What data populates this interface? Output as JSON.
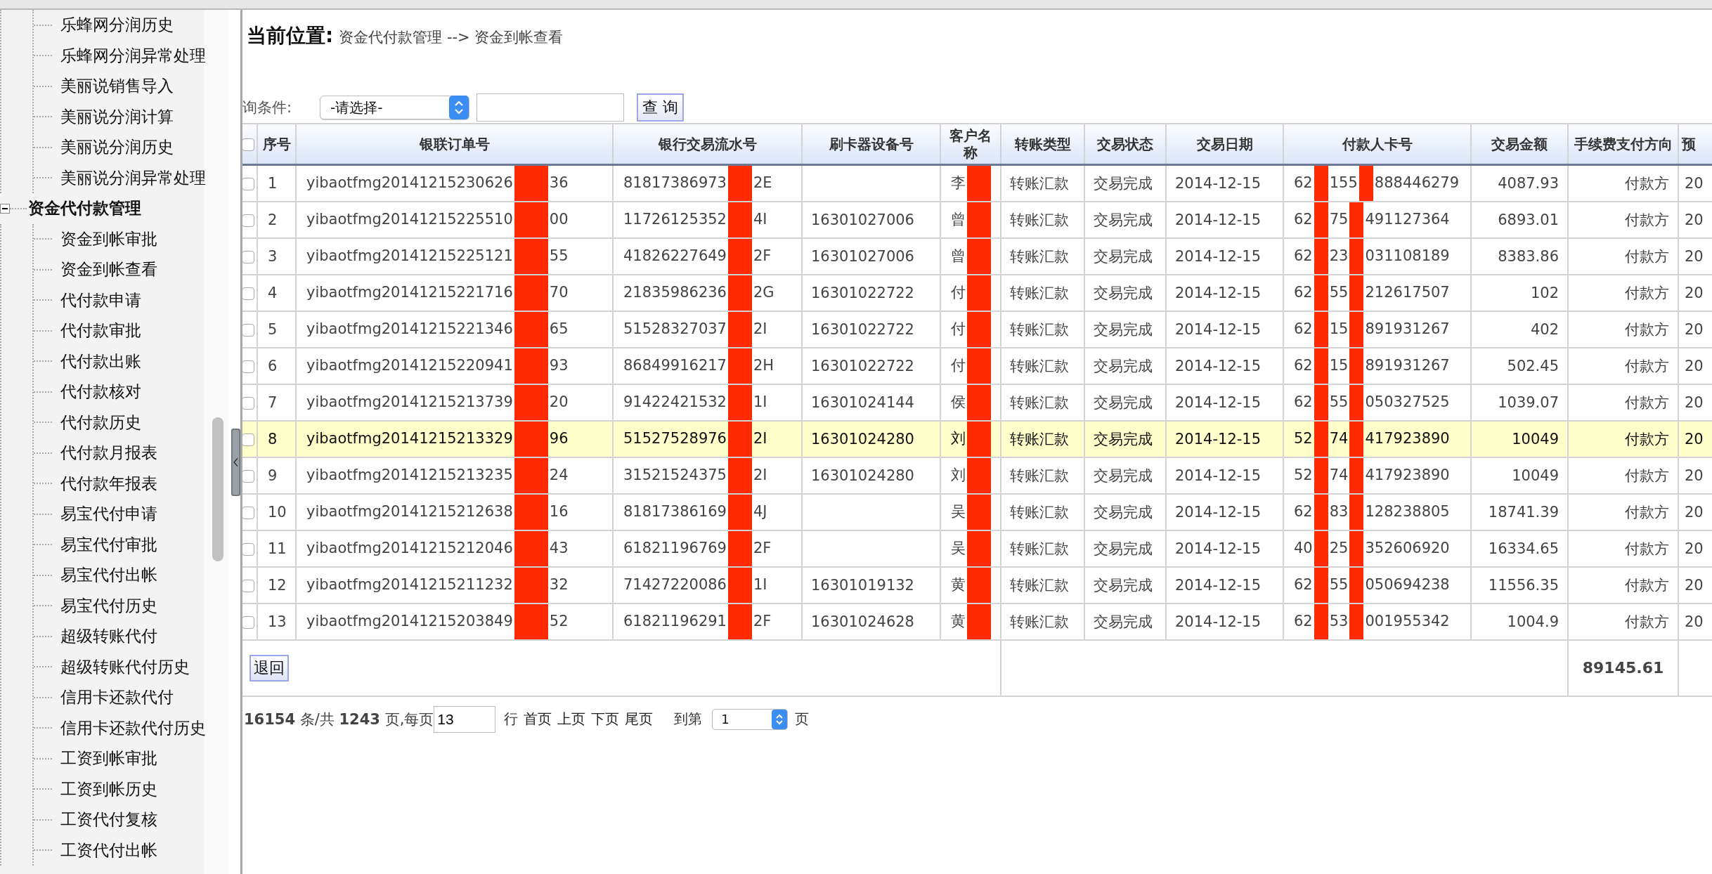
{
  "sidebar": {
    "items": [
      "乐蜂网分润历史",
      "乐蜂网分润异常处理",
      "美丽说销售导入",
      "美丽说分润计算",
      "美丽说分润历史",
      "美丽说分润异常处理"
    ],
    "groups": [
      {
        "label": "资金代付款管理",
        "expanded": true,
        "children": [
          "资金到帐审批",
          "资金到帐查看",
          "代付款申请",
          "代付款审批",
          "代付款出账",
          "代付款核对",
          "代付款历史",
          "代付款月报表",
          "代付款年报表",
          "易宝代付申请",
          "易宝代付审批",
          "易宝代付出帐",
          "易宝代付历史",
          "超级转账代付",
          "超级转账代付历史",
          "信用卡还款代付",
          "信用卡还款代付历史",
          "工资到帐审批",
          "工资到帐历史",
          "工资代付复核",
          "工资代付出帐"
        ]
      }
    ]
  },
  "breadcrumb": {
    "label": "当前位置:",
    "path": "资金代付款管理 --> 资金到帐查看"
  },
  "query": {
    "label": "询条件:",
    "select": "-请选择-",
    "button": "查 询"
  },
  "table": {
    "header_checkbox": {
      "checked": false
    },
    "columns": [
      "序号",
      "银联订单号",
      "银行交易流水号",
      "刷卡器设备号",
      "客户名称",
      "转账类型",
      "交易状态",
      "交易日期",
      "付款人卡号",
      "交易金额",
      "手续费支付方向",
      "预"
    ],
    "rows": [
      {
        "checked": false,
        "highlighted": false,
        "no": "1",
        "order": [
          "yibaotfmg20141215230626",
          "36"
        ],
        "serial": [
          "81817386973",
          "2E"
        ],
        "name": "李",
        "type": "转账汇款",
        "status": "交易完成",
        "date": "2014-12-15",
        "card": [
          "62",
          "155",
          "888446279"
        ],
        "amount": "4087.93",
        "fee_payer": "付款方",
        "column_13": "20"
      },
      {
        "checked": false,
        "highlighted": false,
        "no": "2",
        "order": [
          "yibaotfmg20141215225510",
          "00"
        ],
        "serial": [
          "11726125352",
          "4I"
        ],
        "device": "16301027006",
        "name": "曾",
        "type": "转账汇款",
        "status": "交易完成",
        "date": "2014-12-15",
        "card": [
          "62",
          "75",
          "491127364"
        ],
        "amount": "6893.01",
        "fee_payer": "付款方",
        "column_13": "20"
      },
      {
        "checked": false,
        "highlighted": false,
        "no": "3",
        "order": [
          "yibaotfmg20141215225121",
          "55"
        ],
        "serial": [
          "41826227649",
          "2F"
        ],
        "device": "16301027006",
        "name": "曾",
        "type": "转账汇款",
        "status": "交易完成",
        "date": "2014-12-15",
        "card": [
          "62",
          "23",
          "031108189"
        ],
        "amount": "8383.86",
        "fee_payer": "付款方",
        "column_13": "20"
      },
      {
        "checked": false,
        "highlighted": false,
        "no": "4",
        "order": [
          "yibaotfmg20141215221716",
          "70"
        ],
        "serial": [
          "21835986236",
          "2G"
        ],
        "device": "16301022722",
        "name": "付",
        "type": "转账汇款",
        "status": "交易完成",
        "date": "2014-12-15",
        "card": [
          "62",
          "55",
          "212617507"
        ],
        "amount": "102",
        "fee_payer": "付款方",
        "column_13": "20"
      },
      {
        "checked": false,
        "highlighted": false,
        "no": "5",
        "order": [
          "yibaotfmg20141215221346",
          "65"
        ],
        "serial": [
          "51528327037",
          "2I"
        ],
        "device": "16301022722",
        "name": "付",
        "type": "转账汇款",
        "status": "交易完成",
        "date": "2014-12-15",
        "card": [
          "62",
          "15",
          "891931267"
        ],
        "amount": "402",
        "fee_payer": "付款方",
        "column_13": "20"
      },
      {
        "checked": false,
        "highlighted": false,
        "no": "6",
        "order": [
          "yibaotfmg20141215220941",
          "93"
        ],
        "serial": [
          "86849916217",
          "2H"
        ],
        "device": "16301022722",
        "name": "付",
        "type": "转账汇款",
        "status": "交易完成",
        "date": "2014-12-15",
        "card": [
          "62",
          "15",
          "891931267"
        ],
        "amount": "502.45",
        "fee_payer": "付款方",
        "column_13": "20"
      },
      {
        "checked": false,
        "highlighted": false,
        "no": "7",
        "order": [
          "yibaotfmg20141215213739",
          "20"
        ],
        "serial": [
          "91422421532",
          "1I"
        ],
        "device": "16301024144",
        "name": "侯",
        "type": "转账汇款",
        "status": "交易完成",
        "date": "2014-12-15",
        "card": [
          "62",
          "55",
          "050327525"
        ],
        "amount": "1039.07",
        "fee_payer": "付款方",
        "column_13": "20"
      },
      {
        "checked": false,
        "highlighted": true,
        "no": "8",
        "order": [
          "yibaotfmg20141215213329",
          "96"
        ],
        "serial": [
          "51527528976",
          "2I"
        ],
        "device": "16301024280",
        "name": "刘",
        "type": "转账汇款",
        "status": "交易完成",
        "date": "2014-12-15",
        "card": [
          "52",
          "74",
          "417923890"
        ],
        "amount": "10049",
        "fee_payer": "付款方",
        "column_13": "20"
      },
      {
        "checked": false,
        "highlighted": false,
        "no": "9",
        "order": [
          "yibaotfmg20141215213235",
          "24"
        ],
        "serial": [
          "31521524375",
          "2I"
        ],
        "device": "16301024280",
        "name": "刘",
        "type": "转账汇款",
        "status": "交易完成",
        "date": "2014-12-15",
        "card": [
          "52",
          "74",
          "417923890"
        ],
        "amount": "10049",
        "fee_payer": "付款方",
        "column_13": "20"
      },
      {
        "checked": false,
        "highlighted": false,
        "no": "10",
        "order": [
          "yibaotfmg20141215212638",
          "16"
        ],
        "serial": [
          "81817386169",
          "4J"
        ],
        "name": "吴",
        "type": "转账汇款",
        "status": "交易完成",
        "date": "2014-12-15",
        "card": [
          "62",
          "83",
          "128238805"
        ],
        "amount": "18741.39",
        "fee_payer": "付款方",
        "column_13": "20"
      },
      {
        "checked": false,
        "highlighted": false,
        "no": "11",
        "order": [
          "yibaotfmg20141215212046",
          "43"
        ],
        "serial": [
          "61821196769",
          "2F"
        ],
        "name": "吴",
        "type": "转账汇款",
        "status": "交易完成",
        "date": "2014-12-15",
        "card": [
          "40",
          "25",
          "352606920"
        ],
        "amount": "16334.65",
        "fee_payer": "付款方",
        "column_13": "20"
      },
      {
        "checked": false,
        "highlighted": false,
        "no": "12",
        "order": [
          "yibaotfmg20141215211232",
          "32"
        ],
        "serial": [
          "71427220086",
          "1I"
        ],
        "device": "16301019132",
        "name": "黄",
        "type": "转账汇款",
        "status": "交易完成",
        "date": "2014-12-15",
        "card": [
          "62",
          "55",
          "050694238"
        ],
        "amount": "11556.35",
        "fee_payer": "付款方",
        "column_13": "20"
      },
      {
        "checked": false,
        "highlighted": false,
        "no": "13",
        "order": [
          "yibaotfmg20141215203849",
          "52"
        ],
        "serial": [
          "61821196291",
          "2F"
        ],
        "device": "16301024628",
        "name": "黄",
        "type": "转账汇款",
        "status": "交易完成",
        "date": "2014-12-15",
        "card": [
          "62",
          "53",
          "001955342"
        ],
        "amount": "1004.9",
        "fee_payer": "付款方",
        "column_13": "20"
      }
    ],
    "footer": {
      "button": "退回",
      "total": "89145.61"
    }
  },
  "pagination": {
    "summary": "**16154** 条/共 **1243** 页,每页",
    "page_size": "13",
    "unit": "行",
    "links": [
      "首页",
      "上页",
      "下页",
      "尾页"
    ],
    "goto_label": "到第",
    "page": "1",
    "page_unit": "页"
  }
}
